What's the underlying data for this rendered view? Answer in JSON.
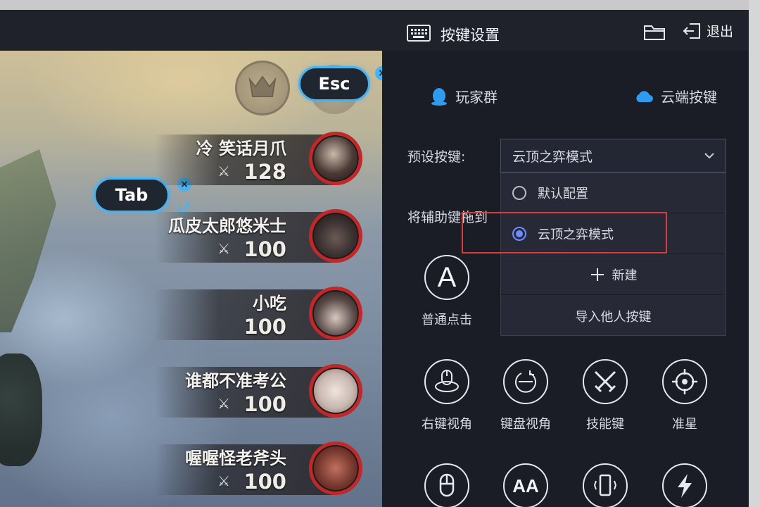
{
  "titlebar": {
    "title": "按键设置",
    "exit_label": "退出",
    "keyboard_icon": "keyboard-icon",
    "folder_icon": "folder-icon",
    "exit_icon": "exit-icon"
  },
  "game": {
    "keys": {
      "esc": "Esc",
      "tab": "Tab"
    },
    "players": [
      {
        "name": "冷 笑话月爪",
        "score": "128"
      },
      {
        "name": "瓜皮太郎悠米士",
        "score": "100"
      },
      {
        "name": "小吃",
        "score": "100"
      },
      {
        "name": "谁都不准考公",
        "score": "100"
      },
      {
        "name": "喔喔怪老斧头",
        "score": "100"
      }
    ],
    "score_icon": "swords-icon"
  },
  "panel": {
    "player_group": "玩家群",
    "cloud_keys": "云端按键",
    "preset_label": "预设按键:",
    "preset_value": "云顶之弈模式",
    "drag_hint": "将辅助键拖到",
    "dropdown": {
      "options": [
        {
          "label": "默认配置",
          "selected": false
        },
        {
          "label": "云顶之弈模式",
          "selected": true
        }
      ],
      "new_label": "新建",
      "import_label": "导入他人按键"
    },
    "keys_row1": [
      {
        "label": "普通点击",
        "icon": "letter-a-icon",
        "glyph": "A"
      }
    ],
    "partial_label": "",
    "keys_row2": [
      {
        "label": "右键视角",
        "icon": "right-click-view-icon"
      },
      {
        "label": "键盘视角",
        "icon": "keyboard-view-icon"
      },
      {
        "label": "技能键",
        "icon": "crossed-swords-icon"
      },
      {
        "label": "准星",
        "icon": "crosshair-icon"
      }
    ],
    "keys_row3": [
      {
        "icon": "mouse-icon"
      },
      {
        "icon": "text-aa-icon",
        "glyph": "AA"
      },
      {
        "icon": "phone-shake-icon"
      },
      {
        "icon": "lightning-icon"
      }
    ]
  },
  "colors": {
    "accent_blue": "#49b2f0",
    "radio_blue": "#6c8cff",
    "highlight_red": "#e03a3a",
    "panel_bg": "#1b1d26"
  }
}
